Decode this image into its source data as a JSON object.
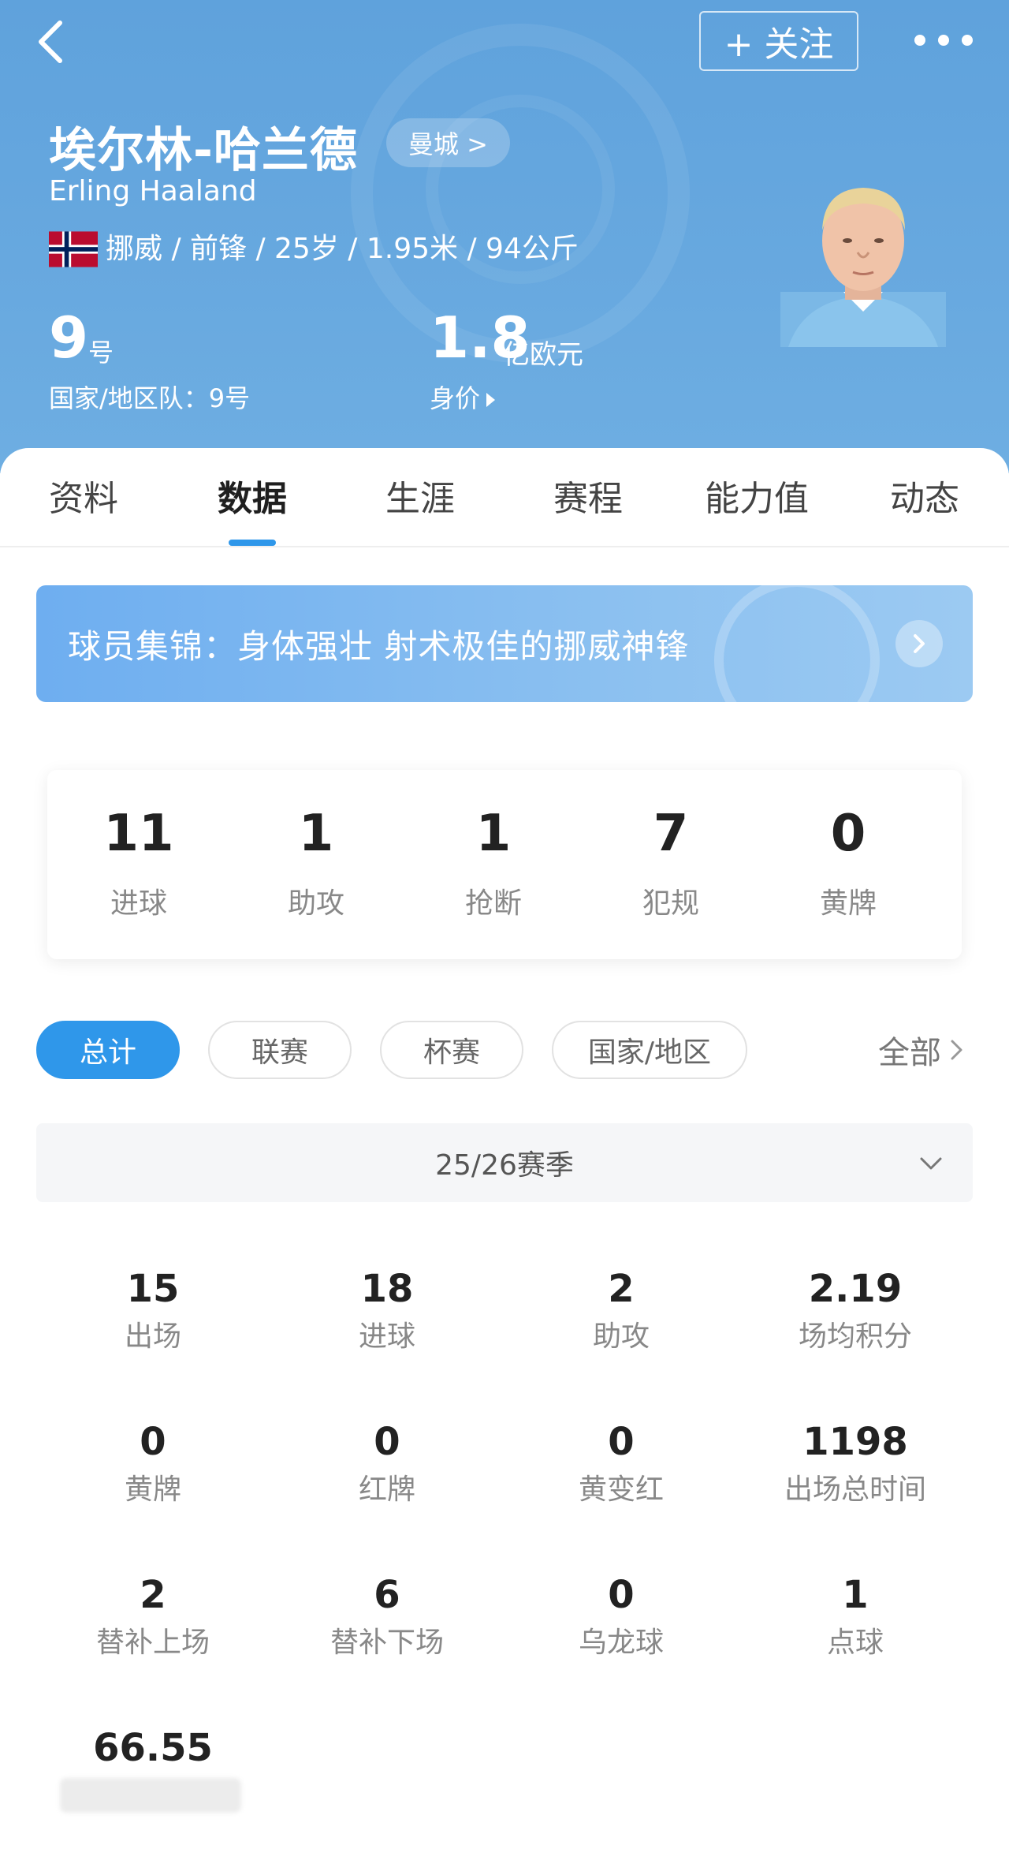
{
  "header": {
    "follow_label": "+ 关注",
    "name_cn": "埃尔林-哈兰德",
    "club": "曼城 >",
    "name_en": "Erling Haaland",
    "info": "挪威 / 前锋 / 25岁 / 1.95米 / 94公斤",
    "jersey_number": "9",
    "jersey_unit": "号",
    "national_number": "国家/地区队：9号",
    "market_value": "1.8",
    "market_value_unit": "亿欧元",
    "market_value_label": "身价"
  },
  "tabs": [
    {
      "label": "资料"
    },
    {
      "label": "数据"
    },
    {
      "label": "生涯"
    },
    {
      "label": "赛程"
    },
    {
      "label": "能力值"
    },
    {
      "label": "动态"
    }
  ],
  "banner": {
    "text": "球员集锦：身体强壮 射术极佳的挪威神锋"
  },
  "summary": [
    {
      "value": "11",
      "label": "进球"
    },
    {
      "value": "1",
      "label": "助攻"
    },
    {
      "value": "1",
      "label": "抢断"
    },
    {
      "value": "7",
      "label": "犯规"
    },
    {
      "value": "0",
      "label": "黄牌"
    }
  ],
  "filters": [
    {
      "label": "总计"
    },
    {
      "label": "联赛"
    },
    {
      "label": "杯赛"
    },
    {
      "label": "国家/地区"
    }
  ],
  "all_link": "全部",
  "season": "25/26赛季",
  "stats": [
    {
      "value": "15",
      "label": "出场"
    },
    {
      "value": "18",
      "label": "进球"
    },
    {
      "value": "2",
      "label": "助攻"
    },
    {
      "value": "2.19",
      "label": "场均积分"
    },
    {
      "value": "0",
      "label": "黄牌"
    },
    {
      "value": "0",
      "label": "红牌"
    },
    {
      "value": "0",
      "label": "黄变红"
    },
    {
      "value": "1198",
      "label": "出场总时间"
    },
    {
      "value": "2",
      "label": "替补上场"
    },
    {
      "value": "6",
      "label": "替补下场"
    },
    {
      "value": "0",
      "label": "乌龙球"
    },
    {
      "value": "1",
      "label": "点球"
    },
    {
      "value": "66.55",
      "label": ""
    }
  ],
  "colors": {
    "accent": "#2f97ea",
    "header_bg": "#67a8df"
  },
  "icons": {
    "back": "back-chevron-icon",
    "more": "more-dots-icon",
    "flag": "norway-flag-icon"
  }
}
